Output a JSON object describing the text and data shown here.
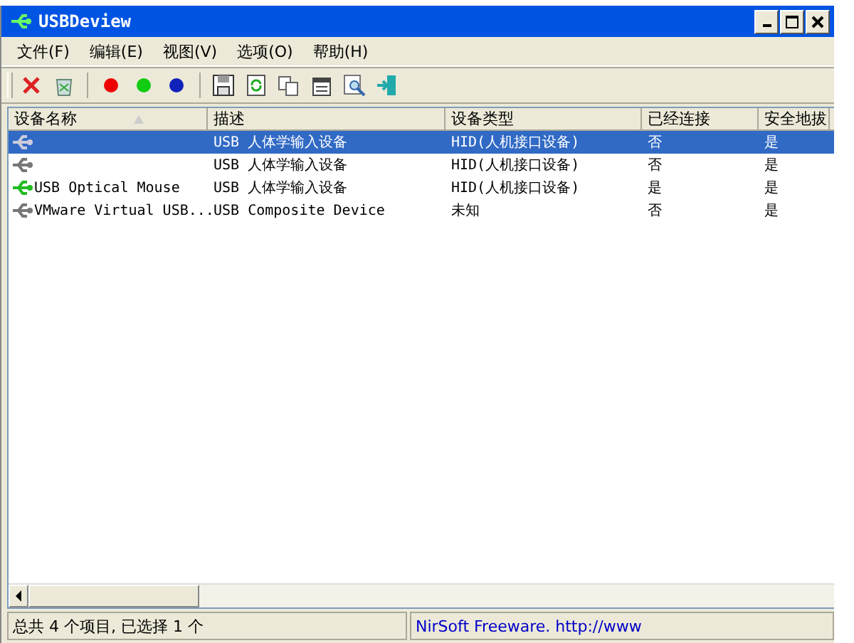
{
  "window": {
    "title": "USBDeview"
  },
  "menu": [
    {
      "label": "文件(F)"
    },
    {
      "label": "编辑(E)"
    },
    {
      "label": "视图(V)"
    },
    {
      "label": "选项(O)"
    },
    {
      "label": "帮助(H)"
    }
  ],
  "table": {
    "columns": [
      {
        "label": "设备名称",
        "sorted": true
      },
      {
        "label": "描述",
        "sorted": false
      },
      {
        "label": "设备类型",
        "sorted": false
      },
      {
        "label": "已经连接",
        "sorted": false
      },
      {
        "label": "安全地拔",
        "sorted": false
      }
    ],
    "rows": [
      {
        "selected": true,
        "connected": false,
        "cells": [
          "",
          "USB 人体学输入设备",
          "HID(人机接口设备)",
          "否",
          "是"
        ]
      },
      {
        "selected": false,
        "connected": false,
        "cells": [
          "",
          "USB 人体学输入设备",
          "HID(人机接口设备)",
          "否",
          "是"
        ]
      },
      {
        "selected": false,
        "connected": true,
        "cells": [
          "USB Optical Mouse",
          "USB 人体学输入设备",
          "HID(人机接口设备)",
          "是",
          "是"
        ]
      },
      {
        "selected": false,
        "connected": false,
        "cells": [
          "VMware Virtual USB...",
          "USB Composite Device",
          "未知",
          "否",
          "是"
        ]
      }
    ]
  },
  "status_bar": {
    "summary": "总共 4 个项目, 已选择 1 个",
    "link": "NirSoft Freeware.  http://www"
  }
}
